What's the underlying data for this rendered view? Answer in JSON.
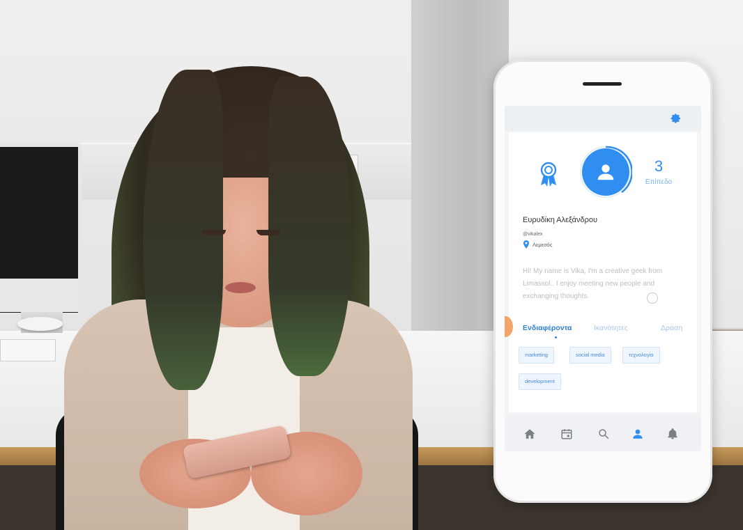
{
  "profile": {
    "level_value": "3",
    "level_label": "Επίπεδο",
    "name": "Ευρυδίκη Αλεξάνδρου",
    "handle": "@vikalex",
    "location": "Λεμεσός",
    "bio": "Hi! My name is Vika, I'm a creative geek from Limassol.. I enjoy meeting new people and exchanging thoughts."
  },
  "tabs": [
    {
      "label": "Ενδιαφέροντα",
      "active": true
    },
    {
      "label": "Ικανότητες",
      "active": false
    },
    {
      "label": "Δράση",
      "active": false
    }
  ],
  "interests": [
    "marketing",
    "social media",
    "τεχνολογία",
    "development"
  ],
  "nav": [
    {
      "icon": "home-icon",
      "active": false
    },
    {
      "icon": "calendar-icon",
      "active": false
    },
    {
      "icon": "search-icon",
      "active": false
    },
    {
      "icon": "profile-icon",
      "active": true
    },
    {
      "icon": "bell-icon",
      "active": false
    }
  ],
  "colors": {
    "accent": "#2f8ef0",
    "inactive_icon": "#7a7f86",
    "chip_text": "#4a8ad6"
  }
}
